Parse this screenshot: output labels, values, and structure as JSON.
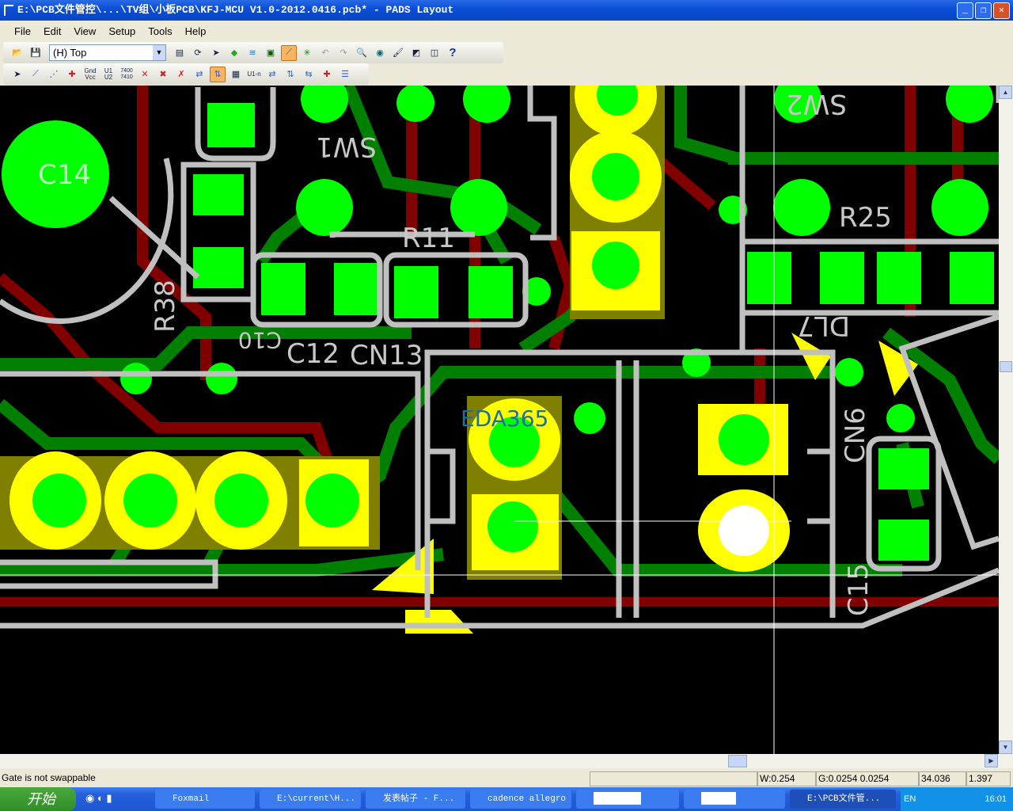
{
  "window": {
    "title": "E:\\PCB文件管控\\...\\TV组\\小板PCB\\KFJ-MCU  V1.0-2012.0416.pcb* - PADS Layout",
    "min": "_",
    "max": "❐",
    "close": "✕"
  },
  "menu": [
    "File",
    "Edit",
    "View",
    "Setup",
    "Tools",
    "Help"
  ],
  "toolbar": {
    "layer_select": "(H) Top"
  },
  "toolbar2_labels": {
    "gnd": "Gnd Vcc",
    "u1u2": "U1 U2",
    "n7400": "7400 7410",
    "u1n": "U1-n"
  },
  "pcb": {
    "labels": {
      "c14": "C14",
      "sw1": "SW1",
      "r11": "R11",
      "r38": "R38",
      "c12": "C12",
      "c10": "C10",
      "cn13": "CN13",
      "r25": "R25",
      "sw2": "SW2",
      "dl7": "DL7",
      "cn6": "CN6",
      "c15": "C15",
      "watermark": "EDA365"
    },
    "colors": {
      "copper": "#007f00",
      "pad": "#00ff00",
      "trace_red": "#800000",
      "outline": "#c0c0c0",
      "drill": "#ffff00"
    }
  },
  "status": {
    "message": "Gate is not swappable",
    "width": "W:0.254",
    "grid": "G:0.0254 0.0254",
    "x": "34.036",
    "y": "1.397"
  },
  "taskbar": {
    "start": "开始",
    "tasks": [
      "Foxmail",
      "E:\\current\\H...",
      "发表帖子 - F...",
      "cadence allegro",
      "",
      "",
      "E:\\PCB文件管..."
    ],
    "lang": "EN",
    "clock": "16:01"
  }
}
